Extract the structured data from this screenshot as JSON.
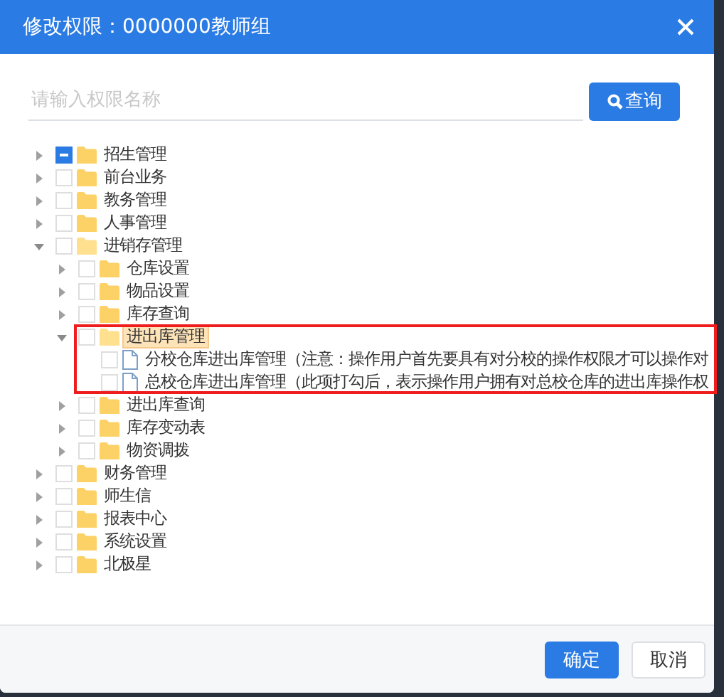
{
  "dialog": {
    "title": "修改权限：0000000教师组",
    "search": {
      "placeholder": "请输入权限名称",
      "button": "查询"
    },
    "tree": [
      {
        "label": "招生管理",
        "kind": "folder",
        "expanded": false,
        "partial": true,
        "selected": false
      },
      {
        "label": "前台业务",
        "kind": "folder",
        "expanded": false,
        "partial": false,
        "selected": false
      },
      {
        "label": "教务管理",
        "kind": "folder",
        "expanded": false,
        "partial": false,
        "selected": false
      },
      {
        "label": "人事管理",
        "kind": "folder",
        "expanded": false,
        "partial": false,
        "selected": false
      },
      {
        "label": "进销存管理",
        "kind": "folder",
        "expanded": true,
        "partial": false,
        "selected": false,
        "children": [
          {
            "label": "仓库设置",
            "kind": "folder",
            "expanded": false,
            "partial": false,
            "selected": false
          },
          {
            "label": "物品设置",
            "kind": "folder",
            "expanded": false,
            "partial": false,
            "selected": false
          },
          {
            "label": "库存查询",
            "kind": "folder",
            "expanded": false,
            "partial": false,
            "selected": false
          },
          {
            "label": "进出库管理",
            "kind": "folder",
            "expanded": true,
            "partial": false,
            "selected": true,
            "annotated": true,
            "children": [
              {
                "label": "分校仓库进出库管理（注意：操作用户首先要具有对分校的操作权限才可以操作对",
                "kind": "file",
                "partial": false,
                "selected": false
              },
              {
                "label": "总校仓库进出库管理（此项打勾后，表示操作用户拥有对总校仓库的进出库操作权",
                "kind": "file",
                "partial": false,
                "selected": false
              }
            ]
          },
          {
            "label": "进出库查询",
            "kind": "folder",
            "expanded": false,
            "partial": false,
            "selected": false
          },
          {
            "label": "库存变动表",
            "kind": "folder",
            "expanded": false,
            "partial": false,
            "selected": false
          },
          {
            "label": "物资调拨",
            "kind": "folder",
            "expanded": false,
            "partial": false,
            "selected": false
          }
        ]
      },
      {
        "label": "财务管理",
        "kind": "folder",
        "expanded": false,
        "partial": false,
        "selected": false
      },
      {
        "label": "师生信",
        "kind": "folder",
        "expanded": false,
        "partial": false,
        "selected": false
      },
      {
        "label": "报表中心",
        "kind": "folder",
        "expanded": false,
        "partial": false,
        "selected": false
      },
      {
        "label": "系统设置",
        "kind": "folder",
        "expanded": false,
        "partial": false,
        "selected": false
      },
      {
        "label": "北极星",
        "kind": "folder",
        "expanded": false,
        "partial": false,
        "selected": false
      }
    ],
    "buttons": [
      {
        "label": "确定",
        "kind": "primary"
      },
      {
        "label": "取消",
        "kind": "default"
      }
    ]
  }
}
